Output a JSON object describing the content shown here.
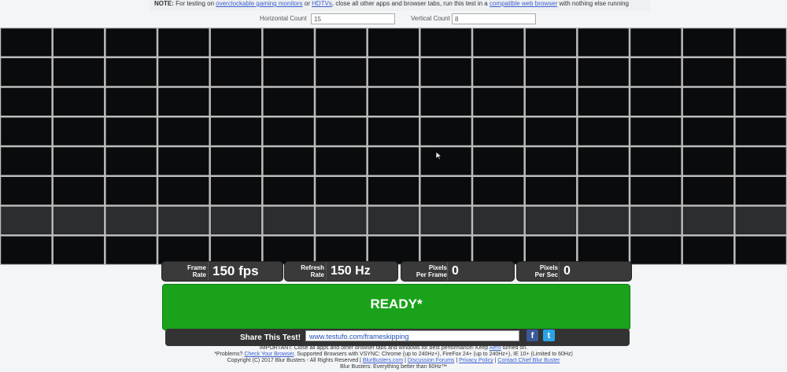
{
  "note": {
    "lead": "NOTE:",
    "t1": " For testing on ",
    "link1": "overclockable gaming monitors",
    "t2": " or ",
    "link2": "HDTVs",
    "t3": ", close all other apps and browser tabs, run this test in a ",
    "link3": "compatible web browser",
    "t4": " with nothing else running"
  },
  "controls": {
    "horizontal_label": "Horizontal Count",
    "horizontal_value": "15",
    "vertical_label": "Vertical Count",
    "vertical_value": "8"
  },
  "grid": {
    "columns": 15,
    "rows": 8,
    "cell_color": "#0a0b0d",
    "line_color": "#bcbcbc",
    "lit_row_color": "#2b2d31"
  },
  "stats": {
    "frame_rate_label_1": "Frame",
    "frame_rate_label_2": "Rate",
    "frame_rate_value": "150 fps",
    "refresh_rate_label_1": "Refresh",
    "refresh_rate_label_2": "Rate",
    "refresh_rate_value": "150 Hz",
    "pixels_per_frame_label_1": "Pixels",
    "pixels_per_frame_label_2": "Per Frame",
    "pixels_per_frame_value": "0",
    "pixels_per_sec_label_1": "Pixels",
    "pixels_per_sec_label_2": "Per Sec",
    "pixels_per_sec_value": "0"
  },
  "status": {
    "text": "READY*",
    "color": "#1aa31a"
  },
  "share": {
    "label": "Share This Test!",
    "url": "www.testufo.com/frameskipping",
    "facebook_glyph": "f",
    "twitter_glyph": "t"
  },
  "footer": {
    "important": "IMPORTANT: Close all apps and other browser tabs and windows for best performance! Keep ",
    "aero_link": "Aero",
    "important_end": " turned on.",
    "problems": "*Problems? ",
    "check_link": "Check Your Browser",
    "supported": ". Supported Browsers with VSYNC: Chrome (up to 240Hz+), FireFox 24+ (up to 240Hz+), IE 10+ (Limited to 60Hz)",
    "copyright": "Copyright (C) 2017 Blur Busters - All Rights Reserved | ",
    "link_bb": "BlurBusters.com",
    "sep1": " | ",
    "link_forums": "Discussion Forums",
    "sep2": " | ",
    "link_privacy": "Privacy Policy",
    "sep3": " | ",
    "link_contact": "Contact Chief Blur Buster",
    "tagline": "Blur Busters: Everything better than 60Hz™"
  }
}
